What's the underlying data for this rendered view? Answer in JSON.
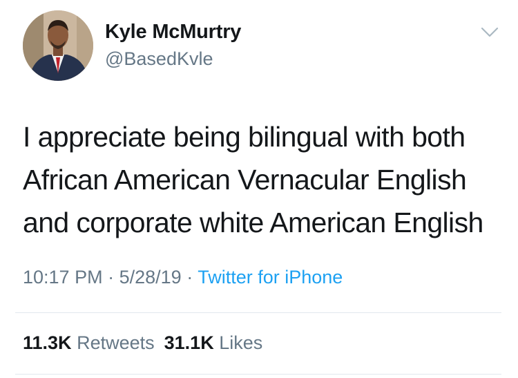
{
  "user": {
    "display_name": "Kyle McMurtry",
    "handle": "@BasedKvle"
  },
  "tweet": {
    "lines": [
      "I appreciate being bilingual with both",
      "African American Vernacular English",
      "and corporate white American English"
    ],
    "time": "10:17 PM",
    "date": "5/28/19",
    "separator": "·",
    "source": "Twitter for iPhone"
  },
  "stats": {
    "retweets_count": "11.3K",
    "retweets_label": "Retweets",
    "likes_count": "31.1K",
    "likes_label": "Likes"
  },
  "icons": {
    "menu": "chevron-down-icon"
  },
  "colors": {
    "text_primary": "#14171a",
    "text_secondary": "#657786",
    "link": "#1da1f2",
    "divider": "#e1e8ed"
  }
}
